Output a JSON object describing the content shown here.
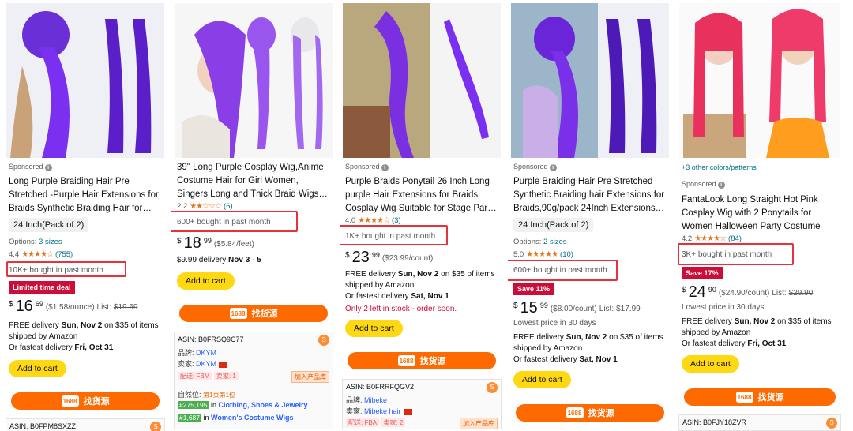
{
  "common": {
    "sponsored": "Sponsored",
    "add_to_cart": "Add to cart",
    "find_source": "找货源",
    "source_logo": "1688",
    "info_icon": "i",
    "kebab": "⋮",
    "src_glyph": "S"
  },
  "colors": {
    "accent_orange": "#ff6a00",
    "cart_yellow": "#ffd814",
    "deal_red": "#cc0c39",
    "highlight_red": "#e8313a",
    "link_teal": "#007185"
  },
  "cards": [
    {
      "title": "Long Purple Braiding Hair Pre Stretched -Purple Hair Extensions for Braids Synthetic Braiding Hair for…",
      "size": "24 Inch(Pack of 2)",
      "options_label": "Options:",
      "options_link": "3 sizes",
      "rating": "4.4",
      "stars": "★★★★☆",
      "rating_count": "(755)",
      "bought": "10K+ bought in past month",
      "deal": "Limited time deal",
      "price_cur": "$",
      "price_whole": "16",
      "price_frac": "69",
      "price_unit": "($1.58/ounce)",
      "list_label": "List:",
      "list_price": "$19.69",
      "delivery1_pre": "FREE delivery",
      "delivery1_date": "Sun, Nov 2",
      "delivery1_post": "on $35 of items shipped by Amazon",
      "delivery2_pre": "Or fastest delivery",
      "delivery2_date": "Fri, Oct 31",
      "asin": "ASIN: B0FPM8SXZZ"
    },
    {
      "title": "39\" Long Purple Cosplay Wig,Anime Costume Hair for Girl Women, Singers Long and Thick Braid Wigs…",
      "rating": "2.2",
      "stars": "★★☆☆☆",
      "rating_count": "(6)",
      "bought": "600+ bought in past month",
      "price_cur": "$",
      "price_whole": "18",
      "price_frac": "99",
      "price_unit": "($5.84/feet)",
      "delivery_price": "$9.99 delivery",
      "delivery_date": "Nov 3 - 5",
      "asin": "ASIN: B0FRSQ9C77",
      "brand_k": "品牌:",
      "brand_v": "DKYM",
      "seller_k": "卖家:",
      "seller_v": "DKYM",
      "ship_k": "配送:",
      "ship_v": "FBM",
      "sellers_k": "卖家:",
      "sellers_v": "1",
      "add_lib": "加入产品库",
      "natural_k": "自然位:",
      "natural_v": "第1页第1位",
      "rank1": "#275,195",
      "rank1_in": "in",
      "rank1_cat": "Clothing, Shoes & Jewelry",
      "rank2": "#1,687",
      "rank2_in": "in",
      "rank2_cat": "Women's Costume Wigs"
    },
    {
      "title": "Purple Braids Ponytail 26 Inch Long purple Hair Extensions for Braids Cosplay Wig Suitable for Stage Par…",
      "rating": "4.0",
      "stars": "★★★★☆",
      "rating_count": "(3)",
      "bought": "1K+ bought in past month",
      "price_cur": "$",
      "price_whole": "23",
      "price_frac": "99",
      "price_unit": "($23.99/count)",
      "delivery1_pre": "FREE delivery",
      "delivery1_date": "Sun, Nov 2",
      "delivery1_post": "on $35 of items shipped by Amazon",
      "delivery2_pre": "Or fastest delivery",
      "delivery2_date": "Sat, Nov 1",
      "stock": "Only 2 left in stock - order soon.",
      "asin": "ASIN: B0FRRFQGV2",
      "brand_k": "品牌:",
      "brand_v": "Mibeke",
      "seller_k": "卖家:",
      "seller_v": "Mibeke hair",
      "ship_k": "配送:",
      "ship_v": "FBA",
      "sellers_k": "卖家:",
      "sellers_v": "2",
      "add_lib": "加入产品库"
    },
    {
      "title": "Purple Braiding Hair Pre Stretched Synthetic Braiding hair Extensions for Braids,90g/pack 24Inch Extensions…",
      "size": "24 Inch(Pack of 2)",
      "options_label": "Options:",
      "options_link": "2 sizes",
      "rating": "5.0",
      "stars": "★★★★★",
      "rating_count": "(10)",
      "bought": "600+ bought in past month",
      "deal": "Save 11%",
      "price_cur": "$",
      "price_whole": "15",
      "price_frac": "99",
      "price_unit": "($8.00/count)",
      "list_label": "List:",
      "list_price": "$17.99",
      "lowest": "Lowest price in 30 days",
      "delivery1_pre": "FREE delivery",
      "delivery1_date": "Sun, Nov 2",
      "delivery1_post": "on $35 of items shipped by Amazon",
      "delivery2_pre": "Or fastest delivery",
      "delivery2_date": "Sat, Nov 1"
    },
    {
      "colors_link": "+3 other colors/patterns",
      "title": "FantaLook Long Straight Hot Pink Cosplay Wig with 2 Ponytails for Women Halloween Party Costume",
      "rating": "4.2",
      "stars": "★★★★☆",
      "rating_count": "(84)",
      "bought": "3K+ bought in past month",
      "deal": "Save 17%",
      "price_cur": "$",
      "price_whole": "24",
      "price_frac": "90",
      "price_unit": "($24.90/count)",
      "list_label": "List:",
      "list_price": "$29.90",
      "lowest": "Lowest price in 30 days",
      "delivery1_pre": "FREE delivery",
      "delivery1_date": "Sun, Nov 2",
      "delivery1_post": "on $35 of items shipped by Amazon",
      "delivery2_pre": "Or fastest delivery",
      "delivery2_date": "Fri, Oct 31",
      "asin": "ASIN: B0FJY18ZVR"
    }
  ]
}
